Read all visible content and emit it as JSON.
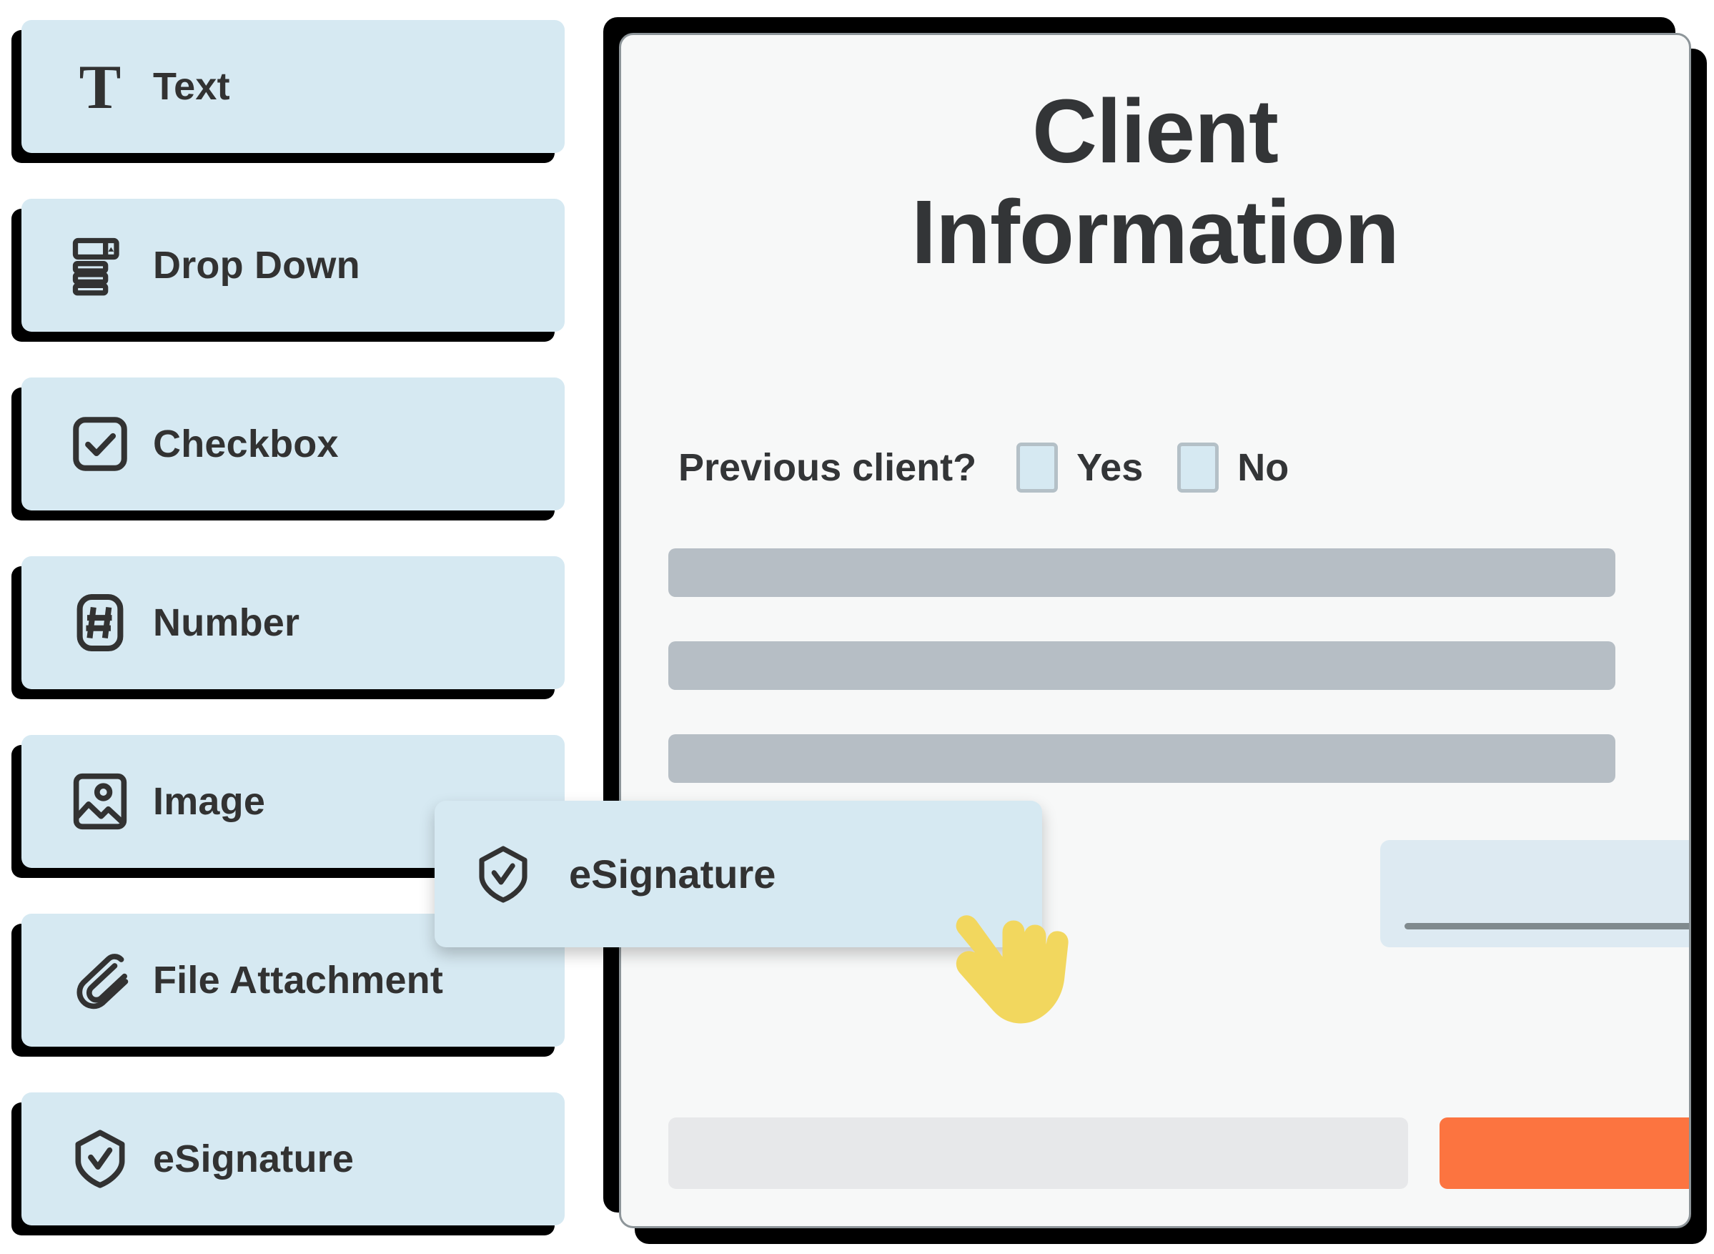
{
  "sidebar": {
    "items": [
      {
        "label": "Text",
        "icon": "text-t-icon"
      },
      {
        "label": "Drop Down",
        "icon": "drop-down-icon"
      },
      {
        "label": "Checkbox",
        "icon": "checkbox-icon"
      },
      {
        "label": "Number",
        "icon": "number-hash-icon"
      },
      {
        "label": "Image",
        "icon": "image-icon"
      },
      {
        "label": "File Attachment",
        "icon": "paperclip-icon"
      },
      {
        "label": "eSignature",
        "icon": "shield-check-icon"
      }
    ]
  },
  "drag_item": {
    "label": "eSignature",
    "icon": "shield-check-icon",
    "cursor": "pointing-hand-cursor"
  },
  "form": {
    "title_line1": "Client",
    "title_line2": "Information",
    "previous_client": {
      "question": "Previous client?",
      "options": [
        {
          "label": "Yes",
          "checked": false
        },
        {
          "label": "No",
          "checked": false
        }
      ]
    },
    "placeholder_rows": 3,
    "signature_field": {
      "line": true
    },
    "footer": {
      "gray_bar": true,
      "primary_button": true
    }
  },
  "colors": {
    "card_blue": "#d6e9f2",
    "signature_blue": "#ddeaf2",
    "panel_bg": "#f7f8f8",
    "panel_border": "#8d9599",
    "placeholder_gray": "#b6bec5",
    "footer_gray": "#e7e8ea",
    "accent_orange": "#fc7440",
    "ink": "#333537",
    "shadow_black": "#000000",
    "cursor_yellow": "#f2d75e",
    "checkbox_border": "#b4c0c7"
  }
}
